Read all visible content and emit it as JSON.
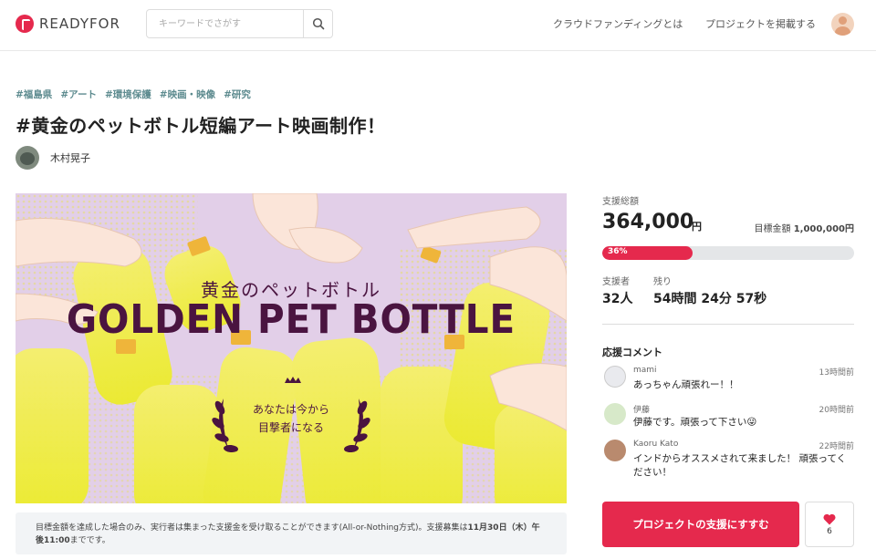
{
  "header": {
    "logo_text": "READYFOR",
    "search_placeholder": "キーワードでさがす",
    "nav": [
      "クラウドファンディングとは",
      "プロジェクトを掲載する"
    ]
  },
  "project": {
    "tags": [
      "#福島県",
      "#アート",
      "#環境保護",
      "#映画・映像",
      "#研究"
    ],
    "title": "#黄金のペットボトル短編アート映画制作！",
    "owner": "木村晃子"
  },
  "hero": {
    "jp_title": "黄金のペットボトル",
    "en_title": "GOLDEN PET BOTTLE",
    "tagline_1": "あなたは今から",
    "tagline_2": "目撃者になる"
  },
  "notice": {
    "text_1": "目標金額を達成した場合のみ、実行者は集まった支援金を受け取ることができます(All-or-Nothing方式)。支援募集は",
    "deadline": "11月30日（木）午後11:00",
    "text_2": "までです。"
  },
  "stats": {
    "total_label": "支援総額",
    "total_amount": "364,000",
    "total_unit": "円",
    "goal_label": "目標金額",
    "goal_amount": "1,000,000円",
    "progress_percent": 36,
    "progress_text": "36%",
    "supporters_label": "支援者",
    "supporters_value": "32人",
    "remaining_label": "残り",
    "remaining_value": "54時間 24分 57秒"
  },
  "comments": {
    "title": "応援コメント",
    "items": [
      {
        "name": "mami",
        "time": "13時間前",
        "text": "あっちゃん頑張れー！！"
      },
      {
        "name": "伊藤",
        "time": "20時間前",
        "text": "伊藤です。頑張って下さい😜"
      },
      {
        "name": "Kaoru Kato",
        "time": "22時間前",
        "text": "インドからオススメされて来ました！ 頑張ってください！"
      }
    ]
  },
  "actions": {
    "support_label": "プロジェクトの支援にすすむ",
    "like_count": "6"
  },
  "colors": {
    "brand": "#e5294d",
    "tag": "#5d8b8f",
    "hero_text": "#4a1440"
  },
  "icons": [
    "readyfor-logo-icon",
    "search-icon",
    "user-avatar-icon",
    "laurel-icon",
    "crown-icon",
    "heart-icon"
  ]
}
